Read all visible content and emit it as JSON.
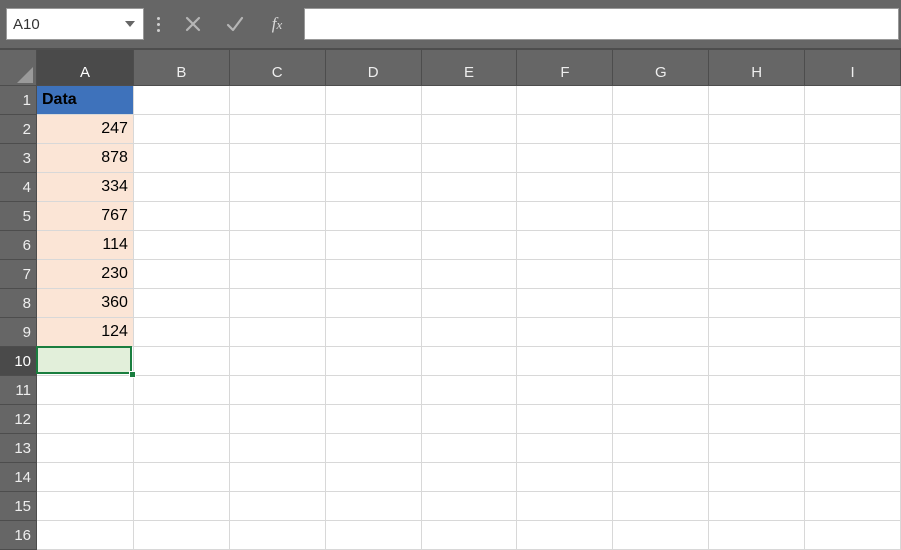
{
  "name_box": "A10",
  "formula_value": "",
  "columns": [
    {
      "label": "A",
      "width": 97,
      "active": true
    },
    {
      "label": "B",
      "width": 96,
      "active": false
    },
    {
      "label": "C",
      "width": 96,
      "active": false
    },
    {
      "label": "D",
      "width": 96,
      "active": false
    },
    {
      "label": "E",
      "width": 96,
      "active": false
    },
    {
      "label": "F",
      "width": 96,
      "active": false
    },
    {
      "label": "G",
      "width": 96,
      "active": false
    },
    {
      "label": "H",
      "width": 96,
      "active": false
    },
    {
      "label": "I",
      "width": 96,
      "active": false
    }
  ],
  "rows": [
    {
      "n": 1,
      "active": false
    },
    {
      "n": 2,
      "active": false
    },
    {
      "n": 3,
      "active": false
    },
    {
      "n": 4,
      "active": false
    },
    {
      "n": 5,
      "active": false
    },
    {
      "n": 6,
      "active": false
    },
    {
      "n": 7,
      "active": false
    },
    {
      "n": 8,
      "active": false
    },
    {
      "n": 9,
      "active": false
    },
    {
      "n": 10,
      "active": true
    },
    {
      "n": 11,
      "active": false
    },
    {
      "n": 12,
      "active": false
    },
    {
      "n": 13,
      "active": false
    },
    {
      "n": 14,
      "active": false
    },
    {
      "n": 15,
      "active": false
    },
    {
      "n": 16,
      "active": false
    }
  ],
  "cells": {
    "A1": {
      "value": "Data",
      "align": "txt",
      "fill": "hdr-fill"
    },
    "A2": {
      "value": "247",
      "align": "num",
      "fill": "data-fill"
    },
    "A3": {
      "value": "878",
      "align": "num",
      "fill": "data-fill"
    },
    "A4": {
      "value": "334",
      "align": "num",
      "fill": "data-fill"
    },
    "A5": {
      "value": "767",
      "align": "num",
      "fill": "data-fill"
    },
    "A6": {
      "value": "114",
      "align": "num",
      "fill": "data-fill"
    },
    "A7": {
      "value": "230",
      "align": "num",
      "fill": "data-fill"
    },
    "A8": {
      "value": "360",
      "align": "num",
      "fill": "data-fill"
    },
    "A9": {
      "value": "124",
      "align": "num",
      "fill": "data-fill"
    }
  },
  "active_cell": {
    "col": "A",
    "row": 10
  },
  "chart_data": {
    "type": "table",
    "title": "Data",
    "categories": [
      "A2",
      "A3",
      "A4",
      "A5",
      "A6",
      "A7",
      "A8",
      "A9"
    ],
    "values": [
      247,
      878,
      334,
      767,
      114,
      230,
      360,
      124
    ]
  }
}
